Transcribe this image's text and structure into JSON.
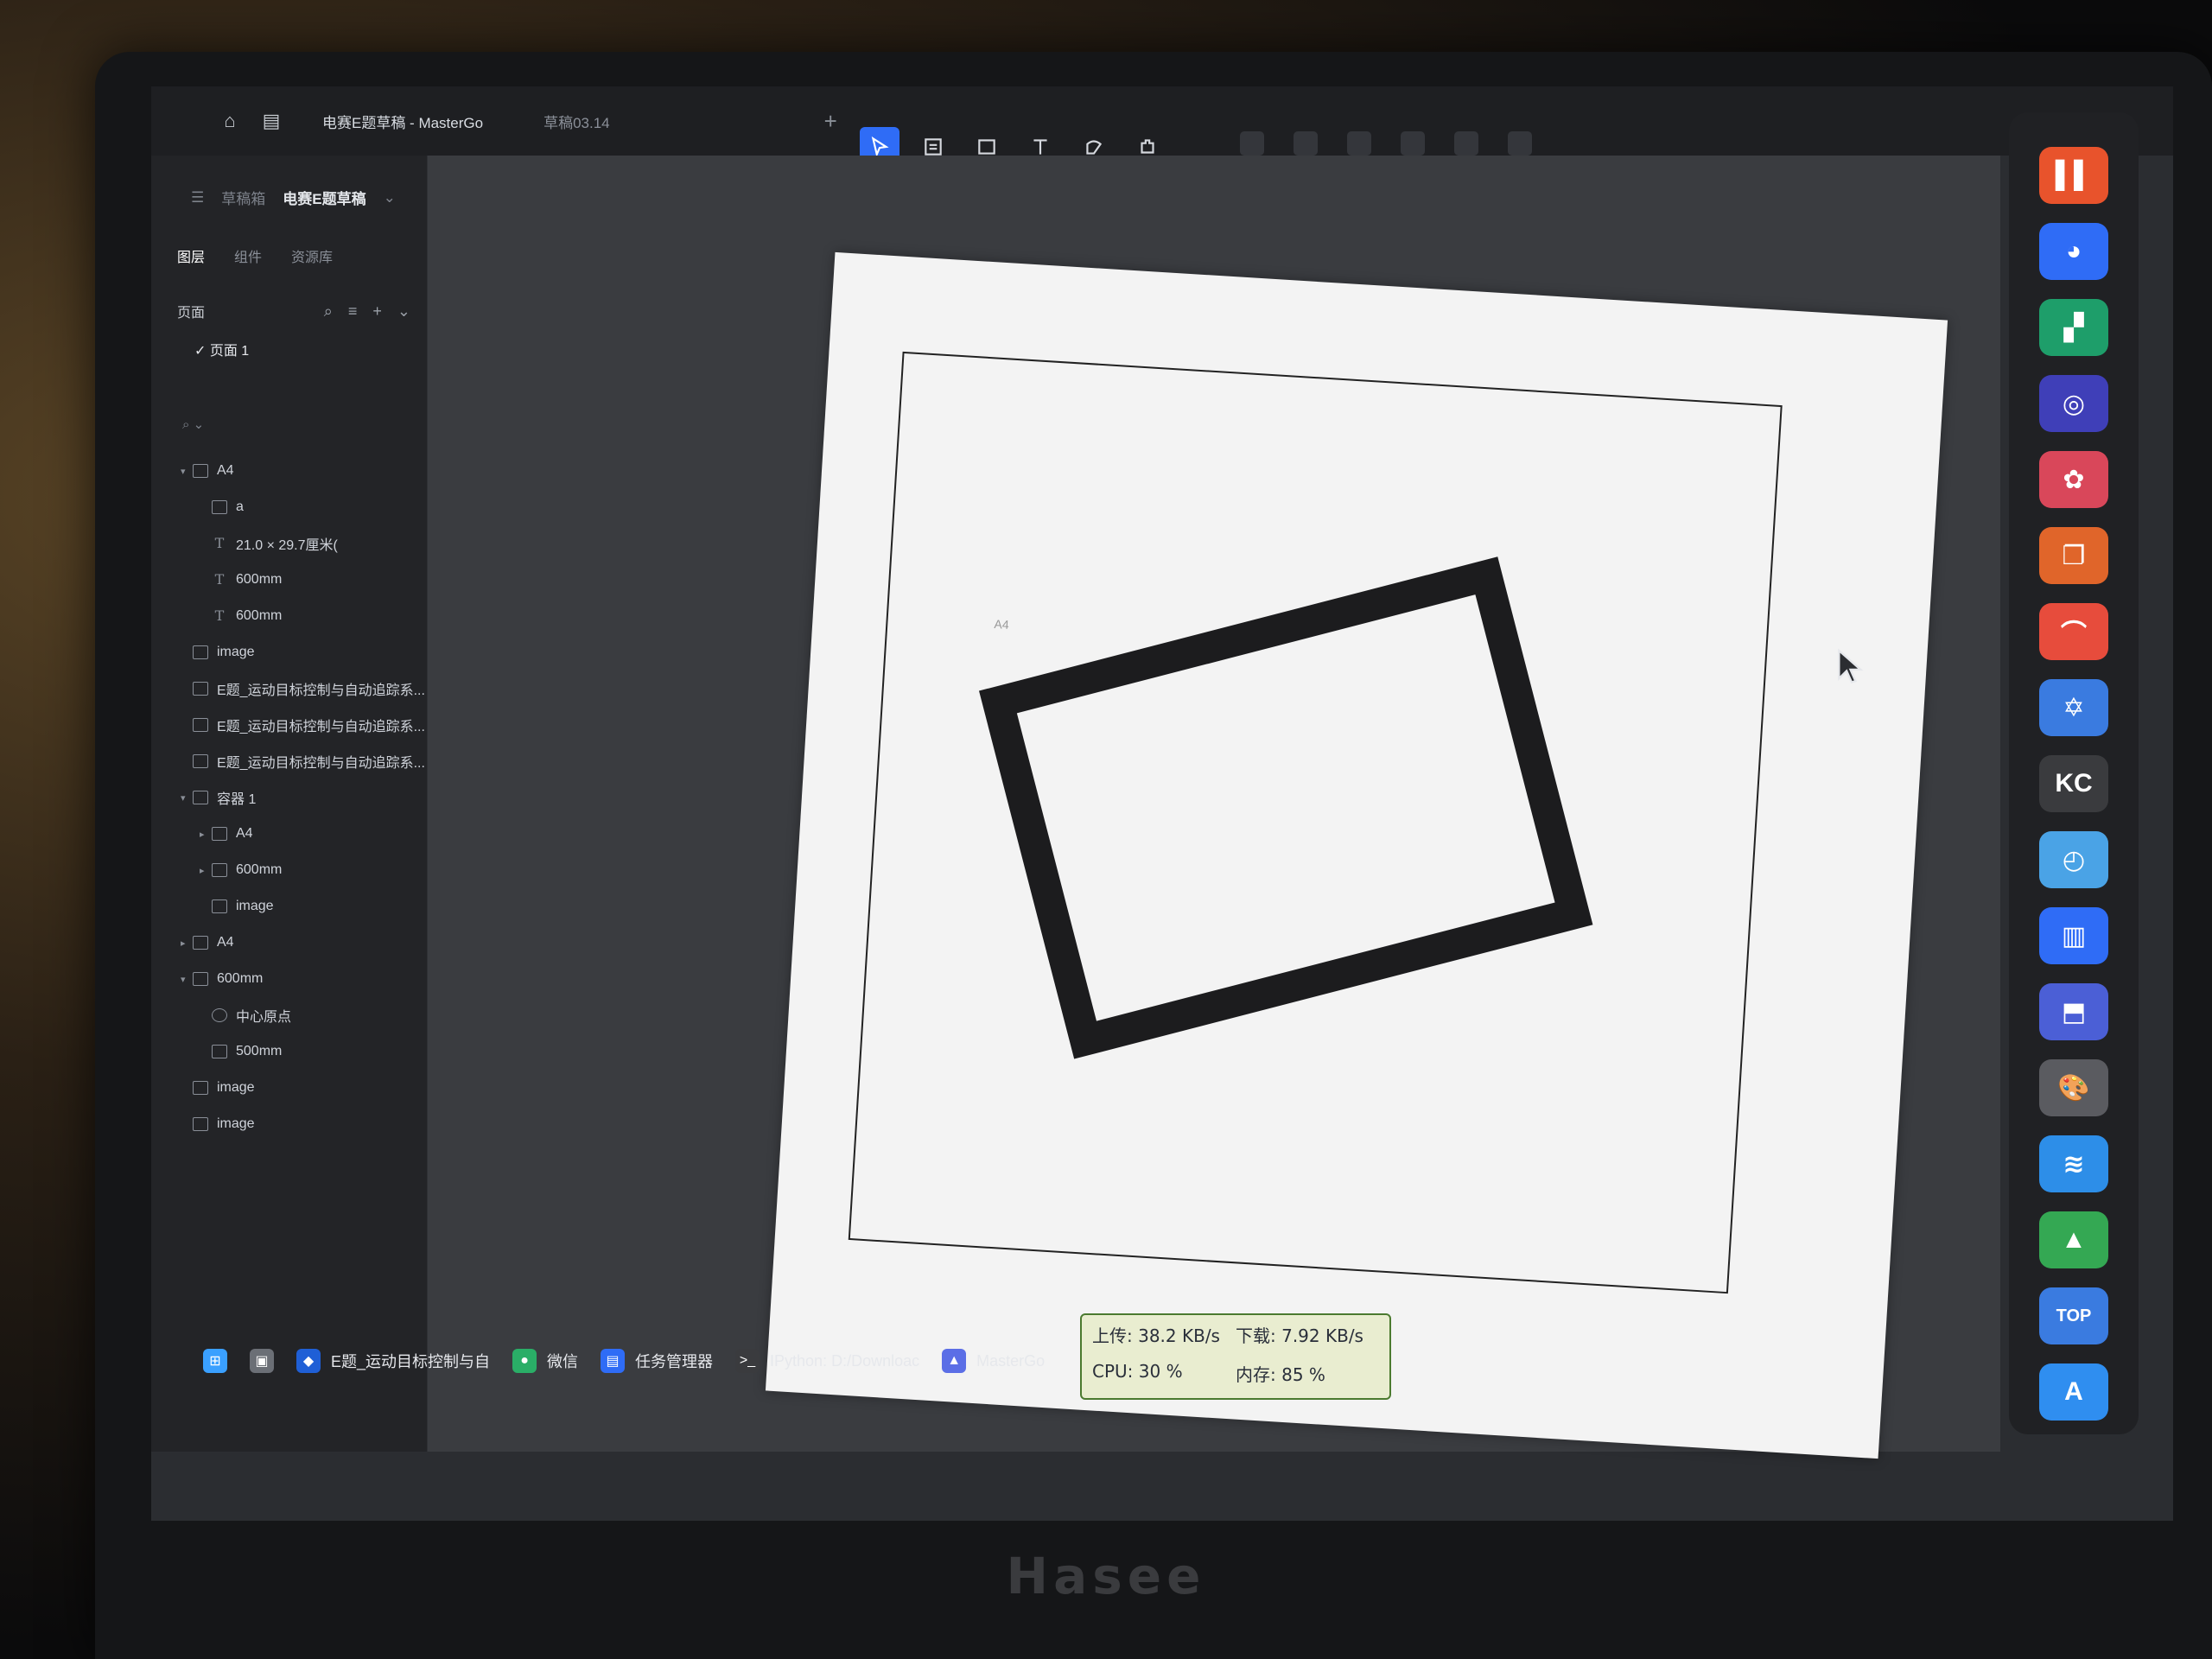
{
  "window": {
    "tabs": [
      {
        "label": "电赛E题草稿 - MasterGo",
        "active": true
      },
      {
        "label": "草稿03.14",
        "active": false
      }
    ],
    "add_tab": "+"
  },
  "toolbar": {
    "tools": [
      {
        "name": "move-tool",
        "active": true
      },
      {
        "name": "frame-tool",
        "active": false
      },
      {
        "name": "rectangle-tool",
        "active": false
      },
      {
        "name": "text-tool",
        "active": false
      },
      {
        "name": "pen-tool",
        "active": false
      },
      {
        "name": "plugin-tool",
        "active": false
      }
    ]
  },
  "file": {
    "drafts_label": "草稿箱",
    "file_name": "电赛E题草稿"
  },
  "panel": {
    "tabs": [
      "图层",
      "组件",
      "资源库"
    ],
    "pages_label": "页面",
    "current_page": "页面 1"
  },
  "layers": [
    {
      "label": "A4",
      "icon": "frame",
      "indent": 0,
      "caret": "▾"
    },
    {
      "label": "a",
      "icon": "frame",
      "indent": 1,
      "caret": ""
    },
    {
      "label": "21.0 × 29.7厘米(",
      "icon": "text",
      "indent": 1,
      "caret": ""
    },
    {
      "label": "600mm",
      "icon": "text",
      "indent": 1,
      "caret": ""
    },
    {
      "label": "600mm",
      "icon": "text",
      "indent": 1,
      "caret": ""
    },
    {
      "label": "image",
      "icon": "frame",
      "indent": 0,
      "caret": ""
    },
    {
      "label": "E题_运动目标控制与自动追踪系...",
      "icon": "frame",
      "indent": 0,
      "caret": ""
    },
    {
      "label": "E题_运动目标控制与自动追踪系...",
      "icon": "frame",
      "indent": 0,
      "caret": ""
    },
    {
      "label": "E题_运动目标控制与自动追踪系...",
      "icon": "frame",
      "indent": 0,
      "caret": ""
    },
    {
      "label": "容器 1",
      "icon": "frame",
      "indent": 0,
      "caret": "▾"
    },
    {
      "label": "A4",
      "icon": "frame",
      "indent": 1,
      "caret": "▸"
    },
    {
      "label": "600mm",
      "icon": "frame",
      "indent": 1,
      "caret": "▸"
    },
    {
      "label": "image",
      "icon": "frame",
      "indent": 1,
      "caret": ""
    },
    {
      "label": "A4",
      "icon": "frame",
      "indent": 0,
      "caret": "▸"
    },
    {
      "label": "600mm",
      "icon": "frame",
      "indent": 0,
      "caret": "▾"
    },
    {
      "label": "中心原点",
      "icon": "circle",
      "indent": 1,
      "caret": ""
    },
    {
      "label": "500mm",
      "icon": "frame",
      "indent": 1,
      "caret": ""
    },
    {
      "label": "image",
      "icon": "frame",
      "indent": 0,
      "caret": ""
    },
    {
      "label": "image",
      "icon": "frame",
      "indent": 0,
      "caret": ""
    }
  ],
  "canvas": {
    "frame_tag": "A4"
  },
  "dock": {
    "apps": [
      {
        "name": "app-orange",
        "color": "#e8532c",
        "glyph": "▌▌"
      },
      {
        "name": "app-bird",
        "color": "#2f6cf6",
        "glyph": "◕"
      },
      {
        "name": "app-green",
        "color": "#1e9e6a",
        "glyph": "▞"
      },
      {
        "name": "app-spiral",
        "color": "#3f3fb8",
        "glyph": "◎"
      },
      {
        "name": "app-pinwheel",
        "color": "#d9475a",
        "glyph": "✿"
      },
      {
        "name": "app-stack",
        "color": "#e0652a",
        "glyph": "❐"
      },
      {
        "name": "app-rainbow",
        "color": "#e74c3c",
        "glyph": "⌒"
      },
      {
        "name": "app-star",
        "color": "#3a7be0",
        "glyph": "✡"
      },
      {
        "name": "app-kc",
        "color": "#3a3b3e",
        "glyph": "KC"
      },
      {
        "name": "app-search",
        "color": "#4aa3e6",
        "glyph": "◴"
      },
      {
        "name": "app-trash",
        "color": "#2f6cf6",
        "glyph": "▥"
      },
      {
        "name": "app-box",
        "color": "#4b5fd6",
        "glyph": "⬒"
      },
      {
        "name": "app-palette",
        "color": "#5a5b60",
        "glyph": "🎨"
      },
      {
        "name": "app-layers",
        "color": "#2d8ee8",
        "glyph": "≋"
      },
      {
        "name": "app-android",
        "color": "#34a853",
        "glyph": "▲"
      },
      {
        "name": "app-top",
        "color": "#3a7be0",
        "glyph": "TOP"
      },
      {
        "name": "app-font",
        "color": "#2f8ef0",
        "glyph": "A"
      }
    ]
  },
  "taskbar": {
    "items": [
      {
        "label": "",
        "icon": "windows-start",
        "color": "#3aa0ff",
        "glyph": "⊞"
      },
      {
        "label": "",
        "icon": "task-view",
        "color": "#6b6f76",
        "glyph": "▣"
      },
      {
        "label": "E题_运动目标控制与自",
        "icon": "app-blue-cube",
        "color": "#1f5fd6",
        "glyph": "◆"
      },
      {
        "label": "微信",
        "icon": "wechat",
        "color": "#2aae67",
        "glyph": "●"
      },
      {
        "label": "任务管理器",
        "icon": "task-manager",
        "color": "#2f6cf6",
        "glyph": "▤"
      },
      {
        "label": "IPython: D:/Downloac",
        "icon": "terminal",
        "color": "#3a3b3e",
        "glyph": ">_"
      },
      {
        "label": "MasterGo",
        "icon": "mastergo",
        "color": "#5b6ee6",
        "glyph": "▲"
      }
    ]
  },
  "netmon": {
    "upload": "上传: 38.2 KB/s",
    "download": "下载: 7.92 KB/s",
    "cpu": "CPU: 30 %",
    "memory": "内存: 85 %"
  },
  "brand": "Hasee"
}
